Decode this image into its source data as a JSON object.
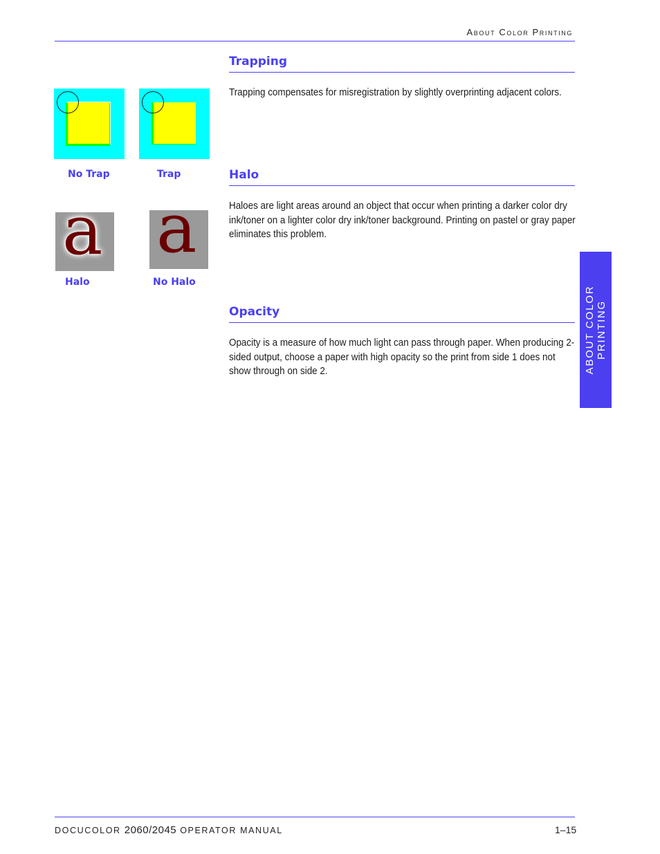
{
  "header": {
    "running_title": "About Color Printing"
  },
  "sections": [
    {
      "title": "Trapping",
      "body": "Trapping compensates for misregistration by slightly overprinting adjacent colors."
    },
    {
      "title": "Halo",
      "body": "Haloes are light areas around an object that occur when printing a darker color dry ink/toner on a lighter color dry ink/toner background. Printing on pastel or gray paper eliminates this problem."
    },
    {
      "title": "Opacity",
      "body": "Opacity is a measure of how much light can pass through paper. When producing 2-sided output, choose a paper with high opacity so the print from side 1 does not show through on side 2."
    }
  ],
  "figures": {
    "trap": [
      {
        "caption": "No Trap"
      },
      {
        "caption": "Trap"
      }
    ],
    "halo": [
      {
        "caption": "Halo",
        "glyph": "a"
      },
      {
        "caption": "No Halo",
        "glyph": "a"
      }
    ]
  },
  "side_tab": {
    "line1": "ABOUT COLOR",
    "line2": "PRINTING"
  },
  "footer": {
    "brand": "DOCUCOLOR ",
    "model": "2060/2045",
    "manual": " OPERATOR MANUAL",
    "page_number": "1–15"
  },
  "colors": {
    "accent": "#4b3ff0",
    "trap_background": "#00ffff",
    "trap_object": "#ffff00",
    "misregistration": "#00ff00",
    "halo_background": "#9a9a9a",
    "glyph": "#6a0000"
  }
}
